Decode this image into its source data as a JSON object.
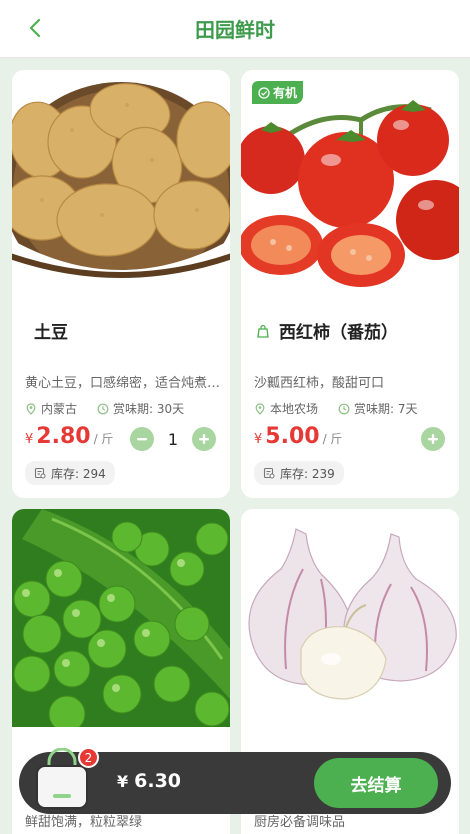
{
  "header": {
    "title": "田园鲜时"
  },
  "products": [
    {
      "name": "土豆",
      "desc": "黄心土豆，口感绵密，适合炖煮煎炒",
      "origin": "内蒙古",
      "shelf": "赏味期: 30天",
      "currency": "¥",
      "price": "2.80",
      "unit": "/ 斤",
      "qty": "1",
      "stock": "库存: 294"
    },
    {
      "badge": "有机",
      "name": "西红柿（番茄）",
      "desc": "沙瓤西红柿，酸甜可口",
      "origin": "本地农场",
      "shelf": "赏味期: 7天",
      "currency": "¥",
      "price": "5.00",
      "unit": "/ 斤",
      "stock": "库存: 239"
    },
    {
      "desc": "鲜甜饱满，粒粒翠绿"
    },
    {
      "desc": "厨房必备调味品"
    }
  ],
  "cart": {
    "count": "2",
    "currency": "¥",
    "total": "6.30",
    "checkout_label": "去结算"
  },
  "colors": {
    "brand": "#4caf50",
    "title": "#3e9a4c",
    "price": "#e53935",
    "background": "#e8f1e8"
  },
  "icons": [
    "back-chevron-icon",
    "check-circle-icon",
    "organic-bag-icon",
    "location-pin-icon",
    "clock-icon",
    "stock-box-icon",
    "minus-icon",
    "plus-icon",
    "shopping-bag-icon"
  ]
}
